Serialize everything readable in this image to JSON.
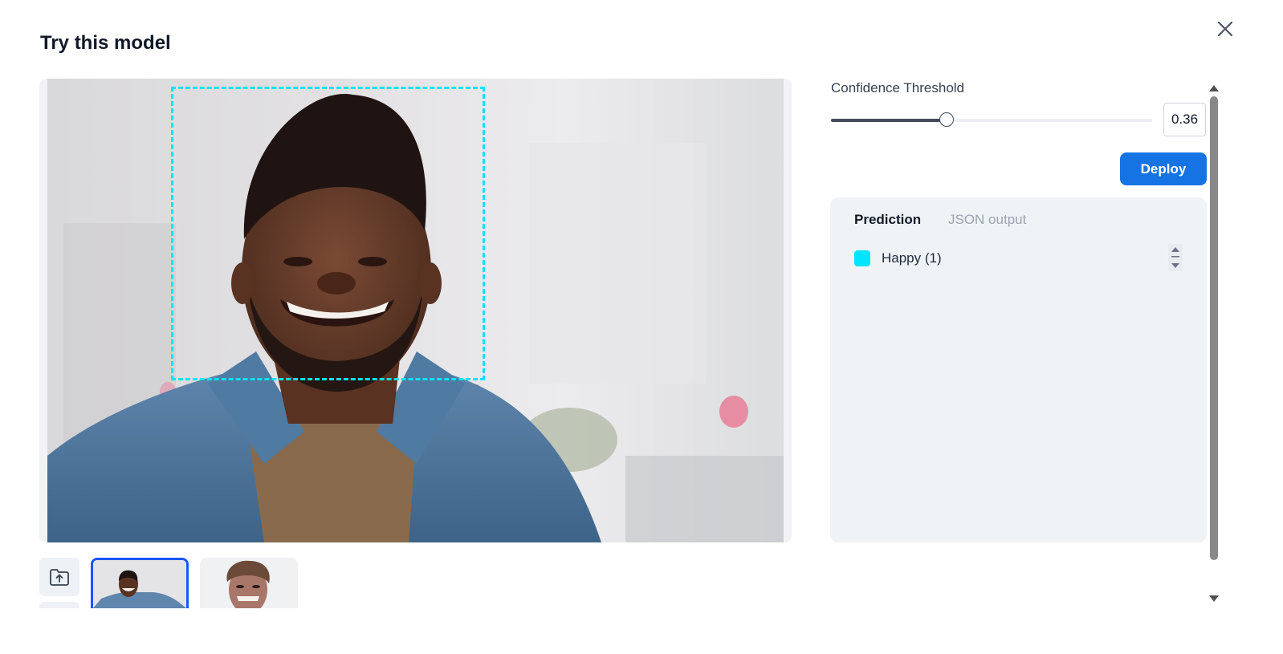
{
  "dialog": {
    "title": "Try this model"
  },
  "confidence": {
    "label": "Confidence Threshold",
    "value": "0.36",
    "fraction": 0.36
  },
  "deploy": {
    "label": "Deploy"
  },
  "tabs": [
    {
      "label": "Prediction",
      "active": true
    },
    {
      "label": "JSON output",
      "active": false
    }
  ],
  "predictions": [
    {
      "label": "Happy (1)",
      "color": "#00e5ff"
    }
  ],
  "colors": {
    "accent": "#1673e4",
    "selection": "#1a56ff",
    "bbox": "#00e5ff"
  },
  "icons": {
    "close": "close-icon",
    "upload": "upload-folder-icon"
  }
}
